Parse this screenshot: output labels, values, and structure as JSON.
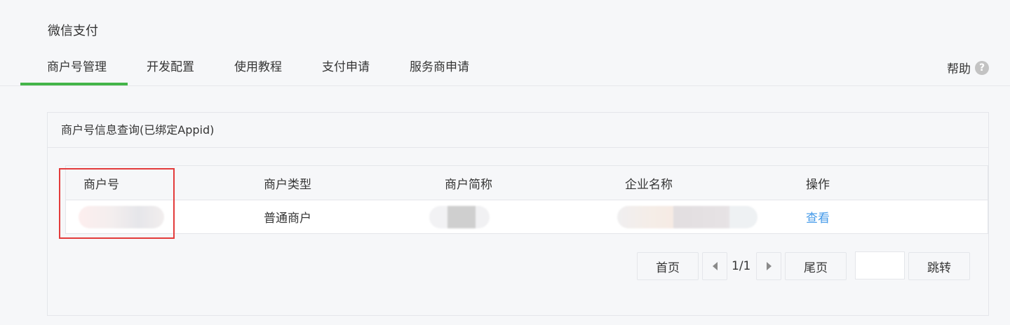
{
  "page": {
    "title": "微信支付"
  },
  "tabs": [
    {
      "label": "商户号管理",
      "active": true
    },
    {
      "label": "开发配置",
      "active": false
    },
    {
      "label": "使用教程",
      "active": false
    },
    {
      "label": "支付申请",
      "active": false
    },
    {
      "label": "服务商申请",
      "active": false
    }
  ],
  "help": {
    "label": "帮助",
    "icon": "question-circle-icon",
    "icon_glyph": "?"
  },
  "panel": {
    "title": "商户号信息查询(已绑定Appid)"
  },
  "table": {
    "columns": [
      "商户号",
      "商户类型",
      "商户简称",
      "企业名称",
      "操作"
    ],
    "rows": [
      {
        "merchant_id": "",
        "merchant_type": "普通商户",
        "merchant_short_name": "",
        "company_name": "",
        "action": "查看"
      }
    ]
  },
  "pagination": {
    "first_label": "首页",
    "prev_icon": "triangle-left-icon",
    "page_indicator": "1/1",
    "next_icon": "triangle-right-icon",
    "last_label": "尾页",
    "jump_value": "",
    "jump_label": "跳转"
  },
  "colors": {
    "accent_green": "#44b549",
    "link_blue": "#459ae9",
    "highlight_red": "#e33b3b"
  }
}
